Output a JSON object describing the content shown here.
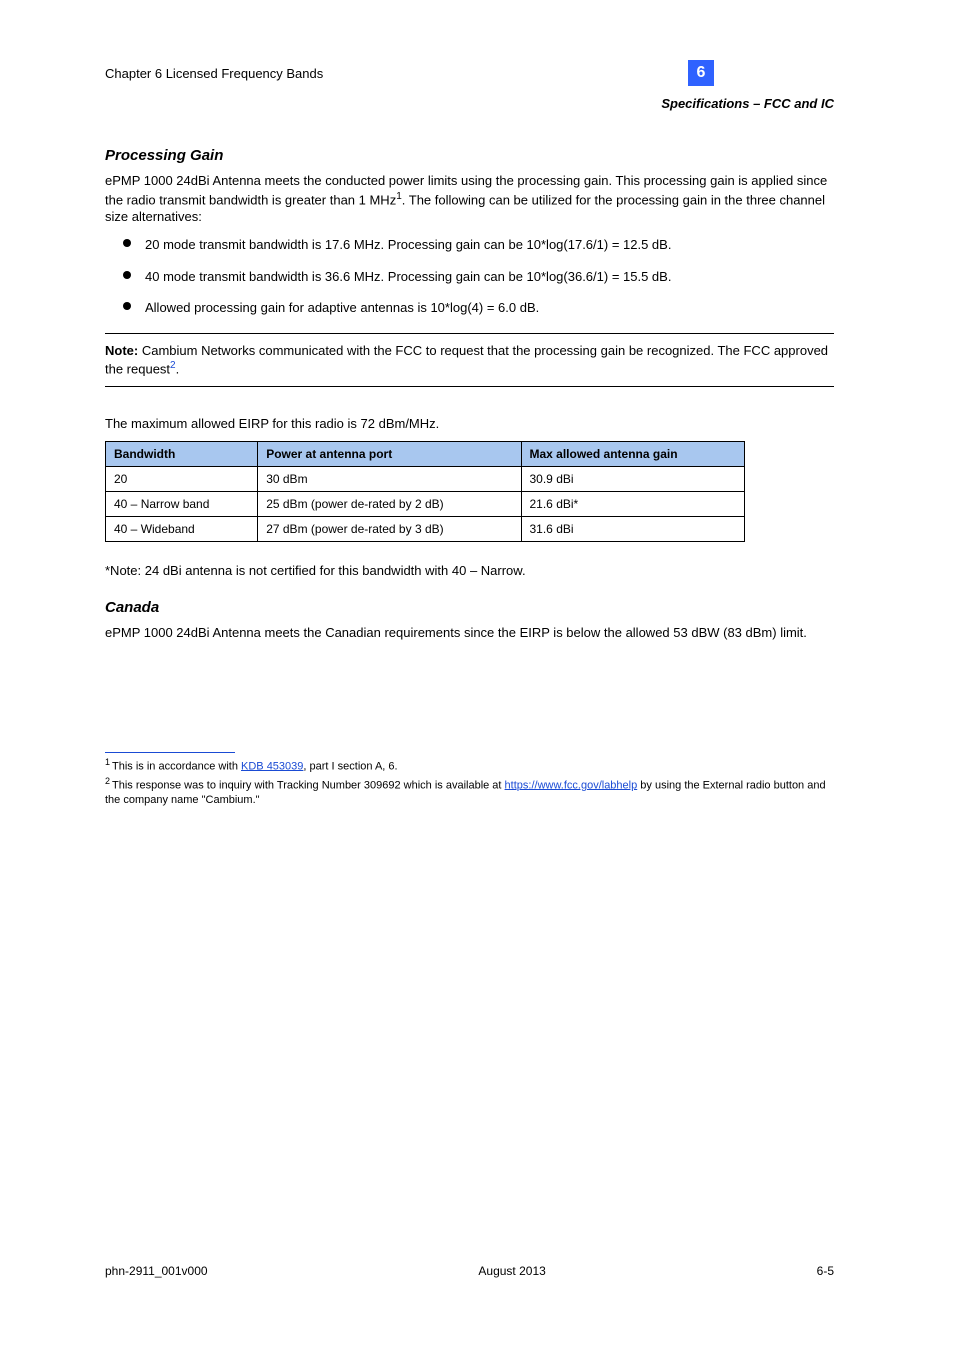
{
  "header": {
    "chapter_label": "Chapter 6 Licensed Frequency Bands",
    "badge": "6",
    "section_sub": "Specifications – FCC and IC"
  },
  "processing_gain": {
    "heading": "Processing Gain",
    "p1_prefix": "ePMP 1000 24dBi Antenna meets the conducted power limits using the processing gain. This processing gain is applied since the radio transmit bandwidth is greater than 1 MHz",
    "p1_suffix": ". The following can be utilized for the processing gain in the three channel size alternatives:",
    "bullets": [
      "20 mode transmit bandwidth is 17.6 MHz. Processing gain can be 10*log(17.6/1) = 12.5 dB.",
      "40 mode transmit bandwidth is 36.6 MHz. Processing gain can be 10*log(36.6/1) = 15.5 dB.",
      "Allowed processing gain for adaptive antennas is 10*log(4) = 6.0 dB."
    ],
    "note_label": "Note:",
    "note_body": " Cambium Networks communicated with the FCC to request that the processing gain be recognized. The FCC approved the request",
    "note_suffix": "."
  },
  "table_intro": "The maximum allowed EIRP for this radio is 72 dBm/MHz.",
  "table": {
    "headers": [
      "Bandwidth",
      "Power at antenna port",
      "Max allowed antenna gain"
    ],
    "rows": [
      [
        "20",
        "30 dBm",
        "30.9 dBi"
      ],
      [
        "40 – Narrow band",
        "25 dBm (power de-rated by 2 dB)",
        "21.6 dBi*"
      ],
      [
        "40 – Wideband",
        "27 dBm (power de-rated by 3 dB)",
        "31.6 dBi"
      ]
    ]
  },
  "asterisk_note": "*Note: 24 dBi antenna is not certified for this bandwidth with 40 – Narrow.",
  "canada": {
    "heading": "Canada",
    "body": "ePMP 1000 24dBi Antenna meets the Canadian requirements since the EIRP is below the allowed 53 dBW (83 dBm) limit."
  },
  "footnotes": [
    {
      "num": "1",
      "prefix": "This is in accordance with ",
      "link_text": "KDB 453039",
      "suffix": ", part I section A, 6."
    },
    {
      "num": "2",
      "prefix": "This response was to inquiry with Tracking Number 309692 which is available at ",
      "link_text": "https://www.fcc.gov/labhelp",
      "suffix": " by using the External radio button and the company name \"Cambium.\""
    }
  ],
  "footer": {
    "left": "phn-2911_001v000",
    "center": "August 2013",
    "right": "6-5"
  }
}
